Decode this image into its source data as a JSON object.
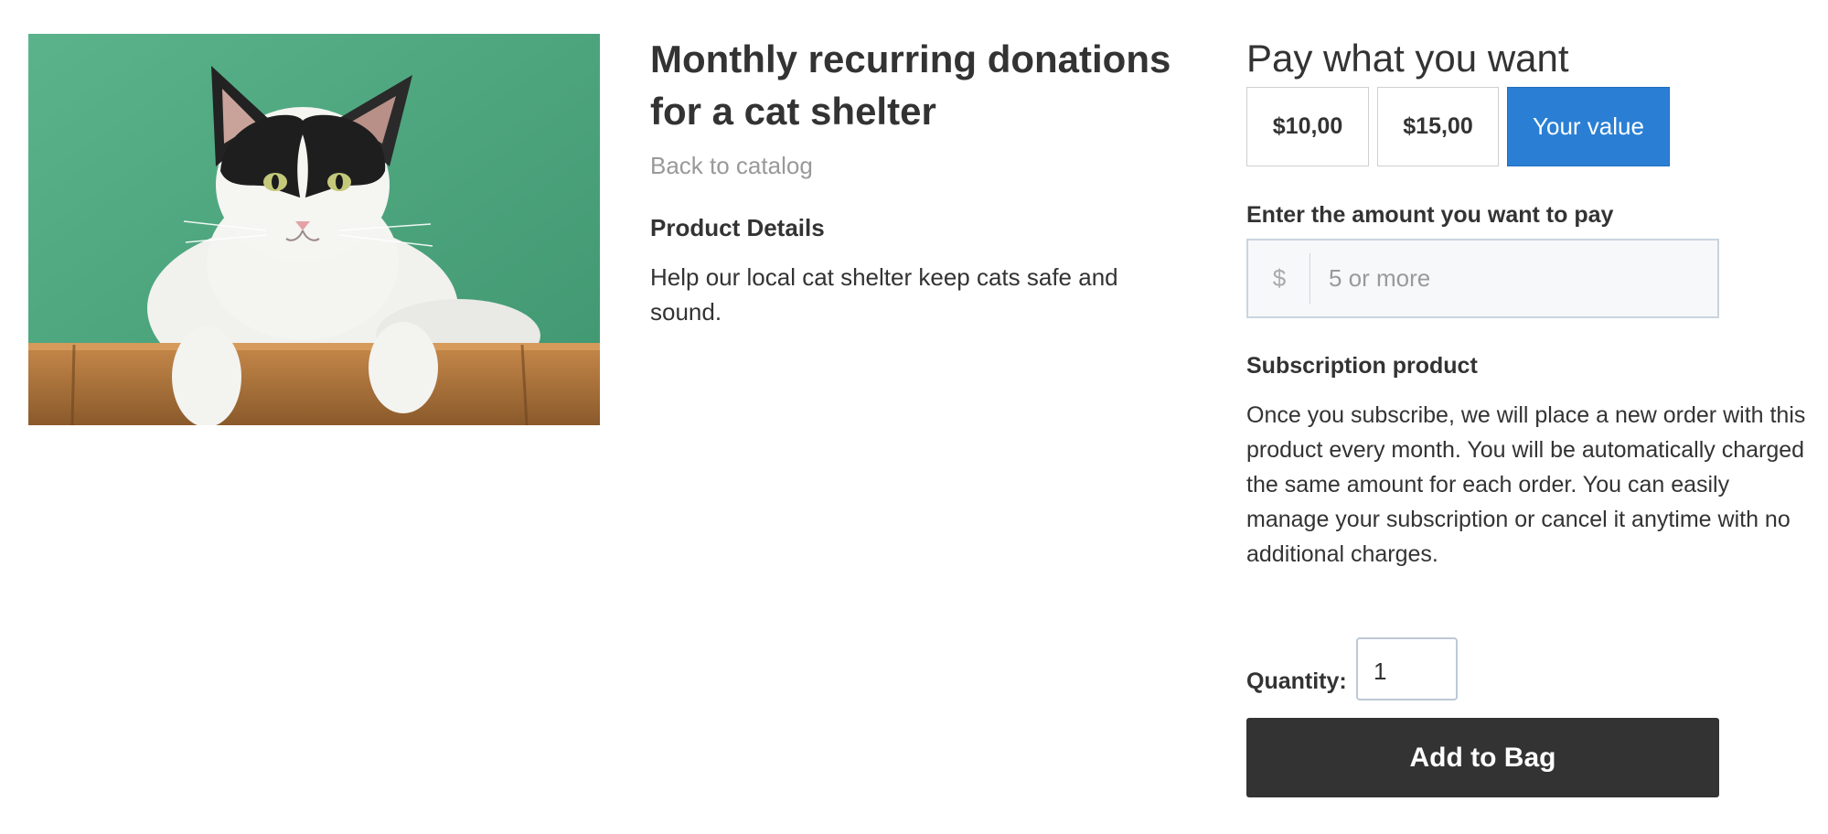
{
  "product": {
    "title": "Monthly recurring donations for a cat shelter",
    "back_link": "Back to catalog",
    "details_heading": "Product Details",
    "details_text": "Help our local cat shelter keep cats safe and sound.",
    "image_icon": "cat-photo"
  },
  "pricing": {
    "title": "Pay what you want",
    "options": [
      {
        "label": "$10,00",
        "selected": false
      },
      {
        "label": "$15,00",
        "selected": false
      },
      {
        "label": "Your value",
        "selected": true
      }
    ],
    "amount_label": "Enter the amount you want to pay",
    "currency_symbol": "$",
    "amount_placeholder": "5 or more",
    "accent_color": "#2a7fd4"
  },
  "subscription": {
    "heading": "Subscription product",
    "text": "Once you subscribe, we will place a new order with this product every month. You will be automatically charged the same amount for each order. You can easily manage your subscription or cancel it anytime with no additional charges."
  },
  "cart": {
    "quantity_label": "Quantity:",
    "quantity_value": "1",
    "add_button": "Add to Bag",
    "button_color": "#333333"
  }
}
